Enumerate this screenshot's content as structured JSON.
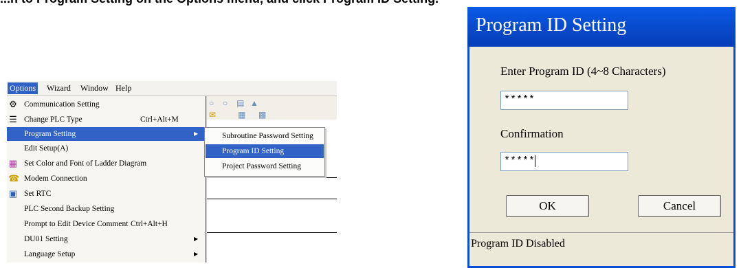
{
  "caption": {
    "text_1": "...n to Program Setting on the Options menu, and click Program ID Setting."
  },
  "menubar": {
    "items": [
      "Options",
      "Wizard",
      "Window",
      "Help"
    ]
  },
  "options_menu": {
    "items": [
      {
        "label": "Communication Setting",
        "icon": "communication-icon"
      },
      {
        "label": "Change PLC Type",
        "shortcut": "Ctrl+Alt+M",
        "icon": "plc-type-icon"
      },
      {
        "label": "Program Setting",
        "submenu": true
      },
      {
        "label": "Edit Setup(A)"
      },
      {
        "label": "Set Color and Font of Ladder Diagram",
        "icon": "color-palette-icon"
      },
      {
        "label": "Modem Connection",
        "icon": "modem-icon"
      },
      {
        "label": "Set RTC",
        "icon": "calendar-icon"
      },
      {
        "label": "PLC Second Backup Setting"
      },
      {
        "label": "Prompt to Edit Device Comment",
        "shortcut": "Ctrl+Alt+H"
      },
      {
        "label": "DU01 Setting",
        "submenu": true
      },
      {
        "label": "Language Setup",
        "submenu": true
      }
    ]
  },
  "program_submenu": {
    "items": [
      "Subroutine Password Setting",
      "Program ID Setting",
      "Project Password Setting"
    ]
  },
  "dialog": {
    "title": "Program ID Setting",
    "enter_label": "Enter Program ID (4~8 Characters)",
    "enter_value": "*****",
    "confirm_label": "Confirmation",
    "confirm_value": "*****",
    "ok_label": "OK",
    "cancel_label": "Cancel",
    "status": "Program ID Disabled"
  },
  "colors": {
    "highlight": "#3162c5",
    "dialog_title_bar": "#0848c8",
    "dialog_body": "#ece9d8"
  }
}
